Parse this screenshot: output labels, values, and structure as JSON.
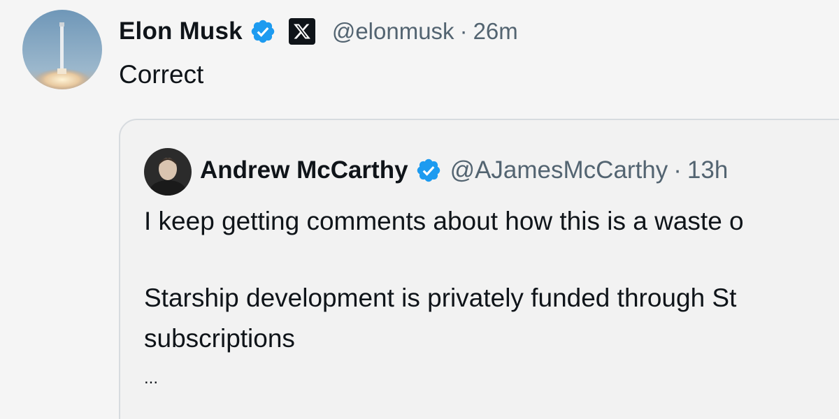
{
  "tweet": {
    "author_name": "Elon Musk",
    "handle": "@elonmusk",
    "separator": "·",
    "time": "26m",
    "text": "Correct",
    "avatar_icon": "rocket-launch-avatar",
    "verified_icon": "verified-badge-icon",
    "affiliation_icon": "x-logo-icon"
  },
  "quote": {
    "author_name": "Andrew McCarthy",
    "handle": "@AJamesMcCarthy",
    "separator": "·",
    "time": "13h",
    "line1": "I keep getting comments about how this is a waste o",
    "line2": "Starship development is privately funded through St",
    "line3": "subscriptions",
    "line4": "...",
    "avatar_icon": "person-avatar",
    "verified_icon": "verified-badge-icon"
  },
  "colors": {
    "background": "#f5f5f5",
    "primary_text": "#0f1419",
    "secondary_text": "#536471",
    "verified_blue": "#1d9bf0",
    "card_border": "#d7dbdf"
  }
}
